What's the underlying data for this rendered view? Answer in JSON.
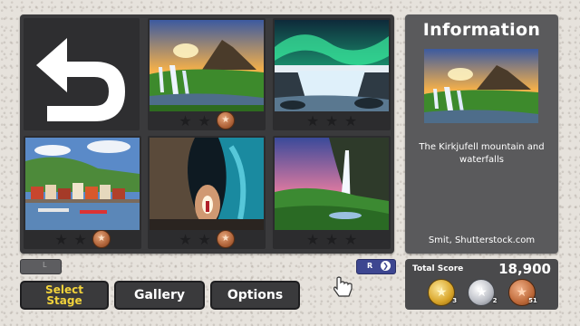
{
  "info": {
    "title": "Information",
    "description": "The Kirkjufell mountain and waterfalls",
    "credit": "Smit, Shutterstock.com"
  },
  "grid": {
    "back_icon": "back-arrow-icon",
    "cells": [
      {
        "name": "kirkjufell",
        "stars_earned": 0,
        "medal": "bronze"
      },
      {
        "name": "aurora-waterfall",
        "stars_earned": 0,
        "medal": "none"
      },
      {
        "name": "harbor-town",
        "stars_earned": 0,
        "medal": "bronze"
      },
      {
        "name": "ice-cave",
        "stars_earned": 0,
        "medal": "bronze"
      },
      {
        "name": "seljalandsfoss",
        "stars_earned": 0,
        "medal": "none"
      }
    ]
  },
  "controls": {
    "l_label": "L",
    "r_label": "R",
    "r_icon": "chevron-right-icon"
  },
  "nav": {
    "select_stage": "Select\nStage",
    "gallery": "Gallery",
    "options": "Options"
  },
  "score": {
    "label": "Total Score",
    "value": "18,900",
    "gold_count": "3",
    "silver_count": "2",
    "bronze_count": "51"
  },
  "colors": {
    "panel": "#3a3a3c",
    "info_panel": "#5a5a5c",
    "active_nav_text": "#f2d33b",
    "r_button": "#3d4690"
  }
}
